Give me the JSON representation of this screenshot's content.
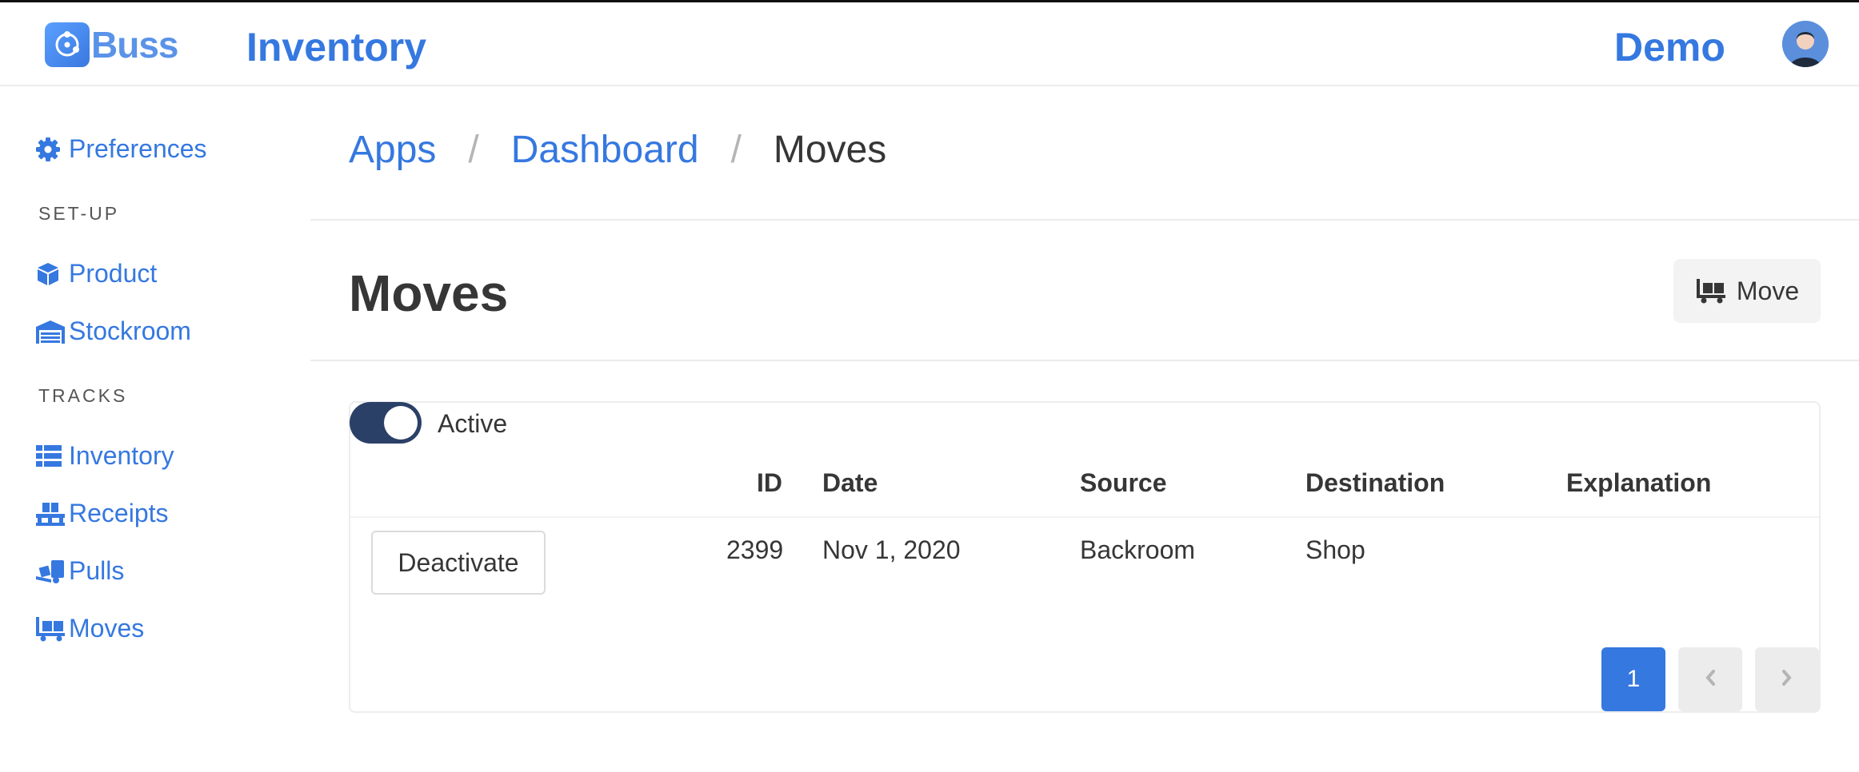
{
  "header": {
    "logo_text": "Buss",
    "app_title": "Inventory",
    "user_name": "Demo",
    "avatar_icon": "user-avatar-icon"
  },
  "sidebar": {
    "preferences": {
      "label": "Preferences",
      "icon": "gear-icon"
    },
    "setup_heading": "SET-UP",
    "setup_items": [
      {
        "label": "Product",
        "icon": "cube-icon"
      },
      {
        "label": "Stockroom",
        "icon": "warehouse-icon"
      }
    ],
    "tracks_heading": "TRACKS",
    "tracks_items": [
      {
        "label": "Inventory",
        "icon": "list-icon"
      },
      {
        "label": "Receipts",
        "icon": "pallet-icon"
      },
      {
        "label": "Pulls",
        "icon": "truck-loading-icon"
      },
      {
        "label": "Moves",
        "icon": "dolly-flatbed-icon"
      }
    ]
  },
  "breadcrumb": {
    "items": [
      "Apps",
      "Dashboard"
    ],
    "separator": "/",
    "current": "Moves"
  },
  "page": {
    "title": "Moves",
    "action_button": {
      "label": "Move",
      "icon": "dolly-flatbed-icon"
    }
  },
  "filter": {
    "toggle_label": "Active",
    "toggle_on": true
  },
  "table": {
    "columns": [
      "ID",
      "Date",
      "Source",
      "Destination",
      "Explanation"
    ],
    "rows": [
      {
        "action": "Deactivate",
        "id": "2399",
        "date": "Nov 1, 2020",
        "source": "Backroom",
        "destination": "Shop",
        "explanation": ""
      }
    ]
  },
  "pagination": {
    "current": "1",
    "prev_icon": "chevron-left-icon",
    "next_icon": "chevron-right-icon"
  },
  "colors": {
    "accent": "#3578e0",
    "toggle_bg": "#2b4066",
    "text": "#363636"
  }
}
